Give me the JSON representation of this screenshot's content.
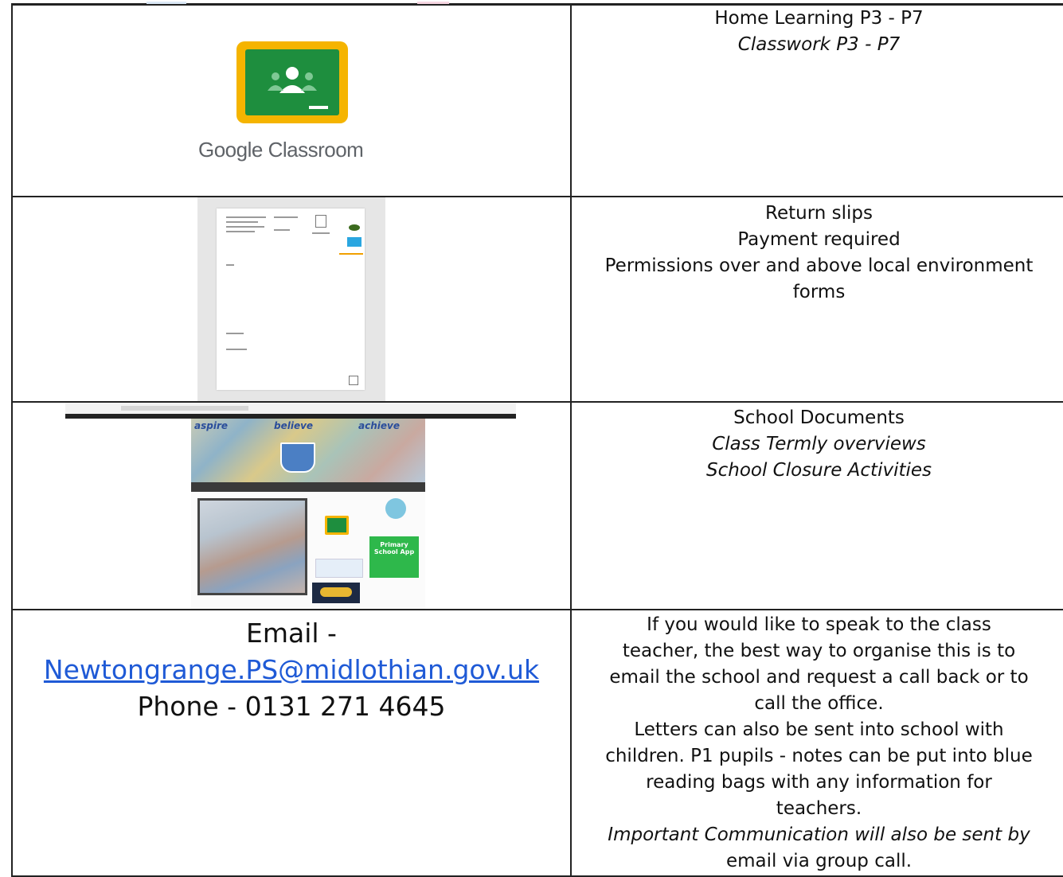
{
  "cells": {
    "google_classroom": {
      "logo_text": "Google Classroom",
      "lines": [
        "Home Learning P3 - P7",
        "Classwork P3 - P7"
      ]
    },
    "return_slips": {
      "lines": [
        "Return slips",
        "Payment required",
        "Permissions over and above local environment",
        "forms"
      ]
    },
    "school_documents": {
      "lines": [
        "School Documents",
        "Class Termly overviews",
        "School Closure Activities"
      ]
    },
    "contact": {
      "email_label": "Email -",
      "email_address": "Newtongrange.PS@midlothian.gov.uk",
      "phone": "Phone - 0131 271 4645",
      "lines": [
        "If you would like to speak to the class",
        "teacher, the best way to organise this is to",
        "email the school and request a call back or to",
        "call the office.",
        "Letters can also be sent into school with",
        "children. P1 pupils - notes can be put into blue",
        "reading bags with any information for",
        "teachers.",
        "Important Communication will also be sent by",
        "email via group call."
      ]
    }
  },
  "website_thumbnail": {
    "banner_words": [
      "aspire",
      "believe",
      "achieve"
    ],
    "app_tile": "Primary School App"
  },
  "colors": {
    "link": "#1f5ad6",
    "gc_yellow": "#f5b400",
    "gc_green": "#1e8e3e",
    "border": "#222222"
  }
}
